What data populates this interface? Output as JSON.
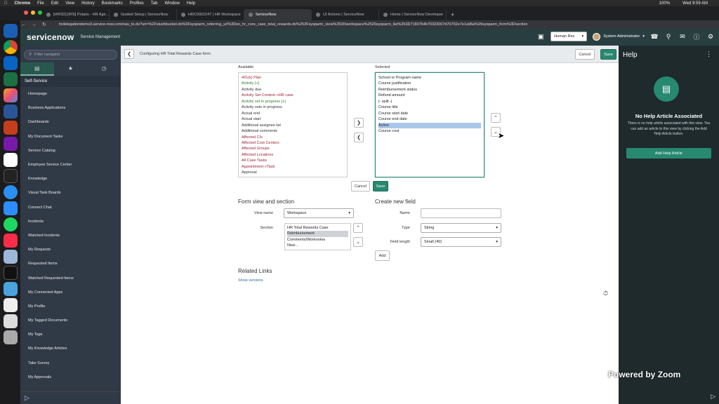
{
  "mac": {
    "items": [
      "Chrome",
      "File",
      "Edit",
      "View",
      "History",
      "Bookmarks",
      "Profiles",
      "Tab",
      "Window",
      "Help"
    ],
    "battery": "100%",
    "time": "Wed 9:59 AM"
  },
  "tabs": [
    "[HRSD] [RIS] Polaris - HR Age...",
    "Guided Setup | ServiceNow",
    "HRC0001047 | HR Workspace",
    "ServiceNow",
    "UI Actions | ServiceNow",
    "Home | ServiceNow Developer"
  ],
  "url": "hrdelegationdemo3.service-now.com/nav_to.do?uri=%2Fslushbucket.do%3Fsysparm_referring_url%3Dsn_hr_core_case_total_rewards.do%253Fsysparm_view%253Dworkspace%2526sysparm_list%253D71837b4b70323007d70702e7e1a96a%26sysparm_form%3Dsection",
  "header": {
    "logo": "servicenow",
    "subtitle": "Service Management",
    "scope": "Human Res",
    "user": "System Administrator"
  },
  "nav": {
    "filter_placeholder": "Filter navigator",
    "section": "Self-Service",
    "items": [
      "Homepage",
      "Business Applications",
      "Dashboards",
      "My Document Tasks",
      "Service Catalog",
      "Employee Service Center",
      "Knowledge",
      "Visual Task Boards",
      "Connect Chat",
      "Incidents",
      "Watched Incidents",
      "My Requests",
      "Requested Items",
      "Watched Requested Items",
      "My Connected Apps",
      "My Profile",
      "My Tagged Documents",
      "My Tags",
      "My Knowledge Articles",
      "Take Survey",
      "My Approvals"
    ]
  },
  "form": {
    "title": "Configuring HR Total Rewards Case form",
    "cancel": "Cancel",
    "save": "Save",
    "available_label": "Available",
    "selected_label": "Selected",
    "available": [
      {
        "t": "401(k) Plan",
        "c": "red"
      },
      {
        "t": "Activity [+]",
        "c": "green"
      },
      {
        "t": "Activity due",
        "c": "dark"
      },
      {
        "t": "Activity Set Context->HR case",
        "c": "red"
      },
      {
        "t": "Activity set in progress [+]",
        "c": "green"
      },
      {
        "t": "Activity sets in progress",
        "c": "dark"
      },
      {
        "t": "Actual end",
        "c": "dark"
      },
      {
        "t": "Actual start",
        "c": "dark"
      },
      {
        "t": "Additional assignee list",
        "c": "dark"
      },
      {
        "t": "Additional comments",
        "c": "dark"
      },
      {
        "t": "Affected CIs",
        "c": "red"
      },
      {
        "t": "Affected Cost Centers",
        "c": "red"
      },
      {
        "t": "Affected Groups",
        "c": "red"
      },
      {
        "t": "Affected Locations",
        "c": "red"
      },
      {
        "t": "All Case Tasks",
        "c": "red"
      },
      {
        "t": "Appointment->Task",
        "c": "red"
      },
      {
        "t": "Approval",
        "c": "dark"
      }
    ],
    "selected": [
      "School or Program name",
      "Course justification",
      "Reimbursement status",
      "Refund amount",
      "|- split -|",
      "Course title",
      "Course start date",
      "Course end date",
      "Active",
      "Course cost"
    ],
    "selected_highlight": "Active",
    "mid_cancel": "Cancel",
    "mid_save": "Save",
    "view_section_title": "Form view and section",
    "view_name_label": "View name",
    "view_name": "Workspace",
    "section_label": "Section",
    "sections": [
      "HR Total Rewards Case",
      "Reimbursement",
      "Comments/Worknotes",
      "New..."
    ],
    "section_highlight": "Reimbursement",
    "create_title": "Create new field",
    "name_label": "Name",
    "type_label": "Type",
    "type_value": "String",
    "length_label": "Field length",
    "length_value": "Small (40)",
    "add": "Add",
    "related_title": "Related Links",
    "show_versions": "Show versions"
  },
  "help": {
    "title": "Help",
    "heading": "No Help Article Associated",
    "body": "There is no help article associated with this view. You can add an article to this view by clicking the Add Help Article button.",
    "button": "Add Help Article"
  },
  "zoom_watermark": "Powered by Zoom",
  "colors": {
    "header": "#293e40",
    "nav": "#303a46",
    "accent": "#278970",
    "help": "#1e2a2c"
  }
}
